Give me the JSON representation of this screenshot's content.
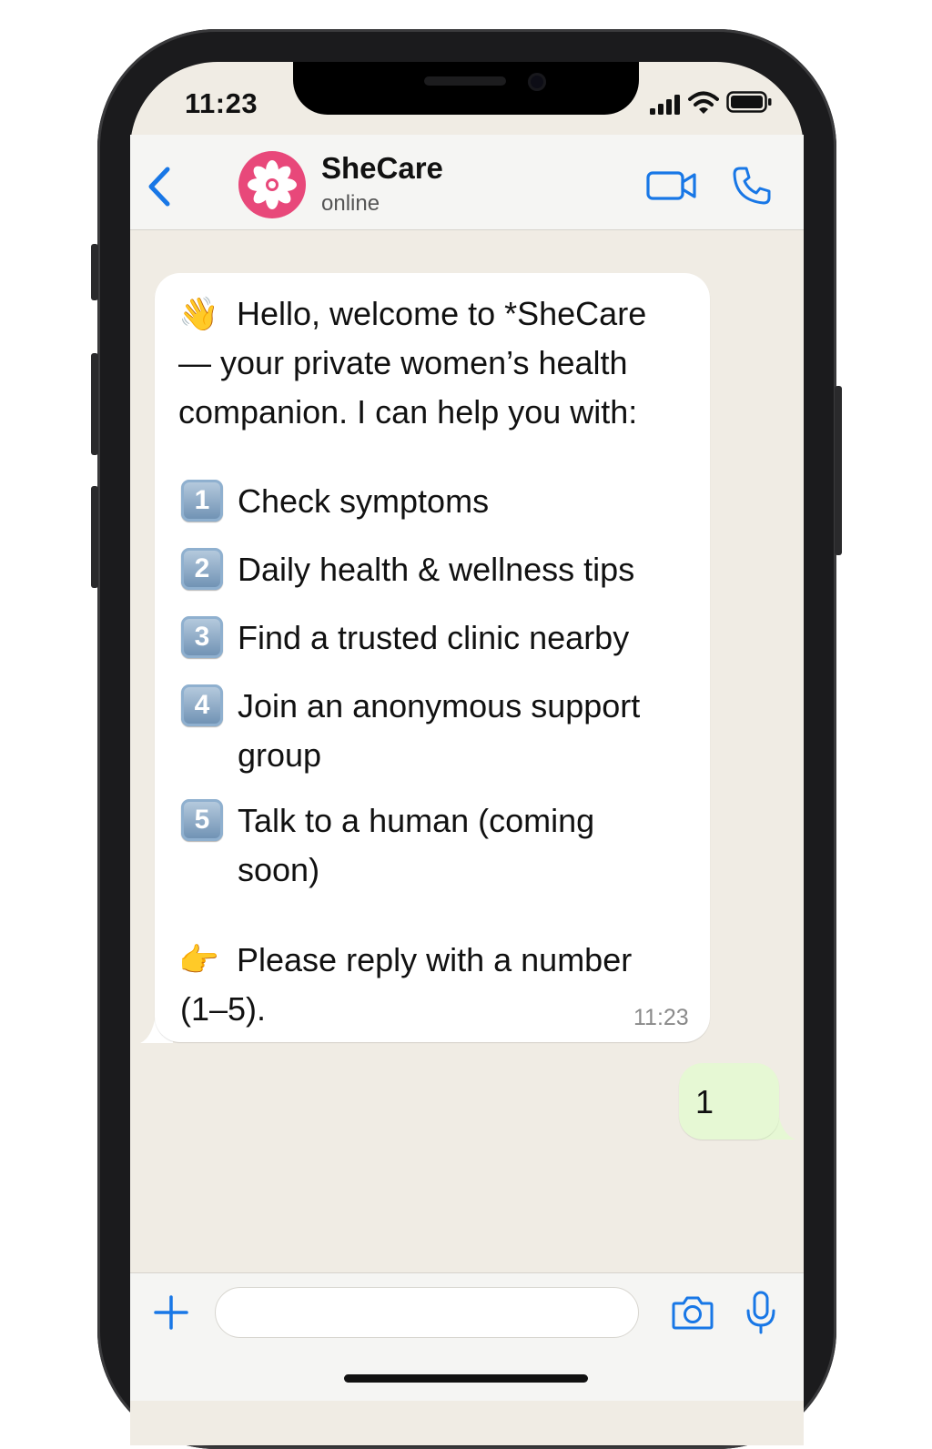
{
  "status_bar": {
    "time": "11:23"
  },
  "header": {
    "contact_name": "SheCare",
    "contact_status": "online",
    "avatar_color": "#e8487a"
  },
  "icons": {
    "back": "chevron-left-icon",
    "video": "video-camera-icon",
    "call": "phone-icon",
    "add": "plus-icon",
    "camera": "camera-icon",
    "mic": "microphone-icon",
    "avatar": "flower-icon"
  },
  "incoming_message": {
    "intro_emoji": "👋",
    "intro_lines": [
      "Hello, welcome to *SheCare",
      "— your private women’s health",
      "companion. I can help you with:"
    ],
    "options": [
      {
        "number": "1",
        "lines": [
          "Check symptoms"
        ]
      },
      {
        "number": "2",
        "lines": [
          "Daily health & wellness tips"
        ]
      },
      {
        "number": "3",
        "lines": [
          "Find a trusted clinic nearby"
        ]
      },
      {
        "number": "4",
        "lines": [
          "Join an anonymous support",
          "group"
        ]
      },
      {
        "number": "5",
        "lines": [
          "Talk to a human (coming",
          "soon)"
        ]
      }
    ],
    "footer_emoji": "👉",
    "footer_lines": [
      "Please reply with a number",
      "(1–5)."
    ],
    "time": "11:23"
  },
  "outgoing_message": {
    "text": "1"
  },
  "composer": {
    "value": "",
    "placeholder": ""
  },
  "colors": {
    "accent": "#1877e6",
    "chat_background": "#f0ece4",
    "incoming_bubble": "#ffffff",
    "outgoing_bubble": "#e6f8d4"
  }
}
